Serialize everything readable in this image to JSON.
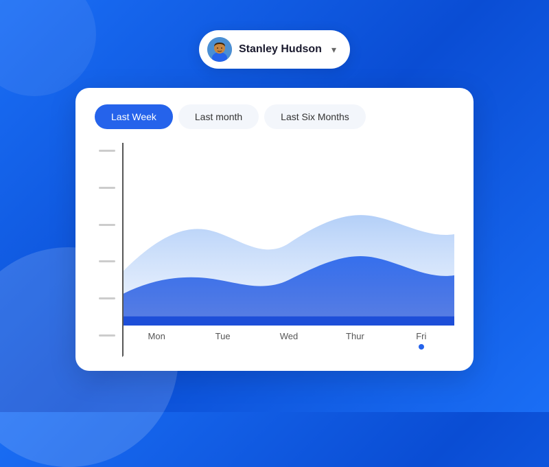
{
  "background": {
    "gradient_start": "#1a6ef5",
    "gradient_end": "#0a4dd4"
  },
  "user_selector": {
    "name": "Stanley Hudson",
    "chevron": "▾"
  },
  "tabs": [
    {
      "label": "Last Week",
      "active": true
    },
    {
      "label": "Last month",
      "active": false
    },
    {
      "label": "Last Six Months",
      "active": false
    }
  ],
  "chart": {
    "x_labels": [
      "Mon",
      "Tue",
      "Wed",
      "Thur",
      "Fri"
    ],
    "active_dot_index": 4,
    "y_ticks": [
      "",
      "",
      "",
      "",
      "",
      ""
    ]
  }
}
